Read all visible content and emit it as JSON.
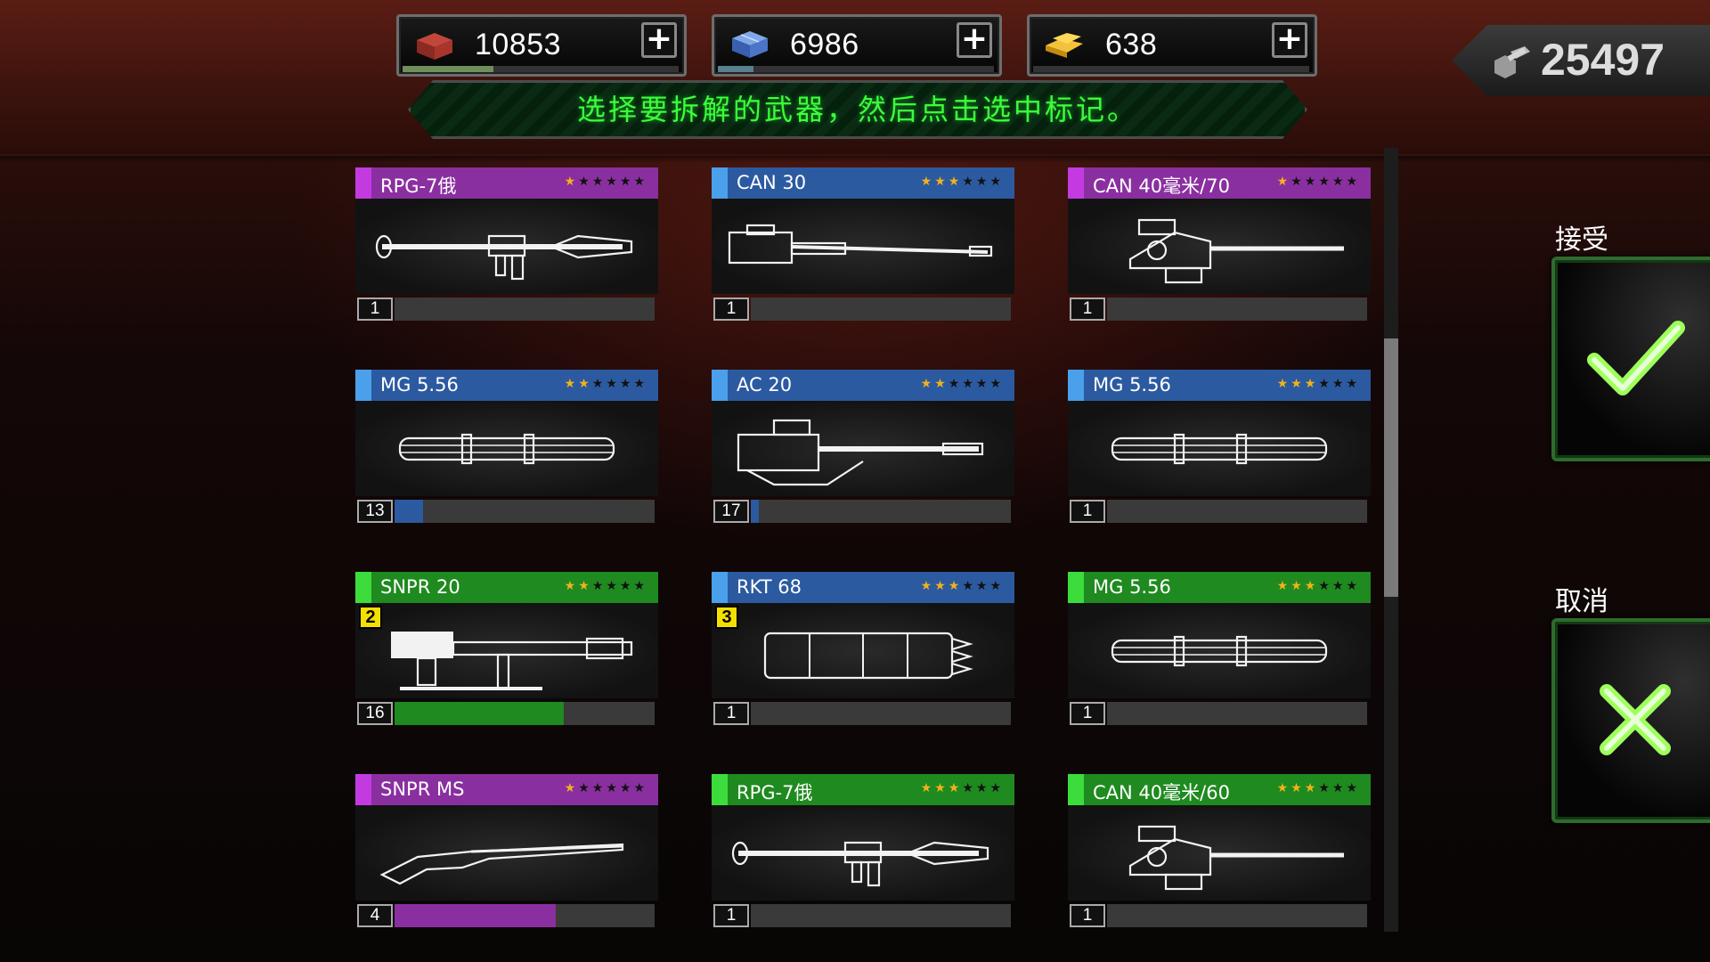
{
  "currencies": [
    {
      "id": "steel",
      "icon": "steel-ingot-icon",
      "value": "10853",
      "bar_fill": 0.33,
      "bar_color": "#6f8f5a"
    },
    {
      "id": "crystal",
      "icon": "blue-crystal-icon",
      "value": "6986",
      "bar_fill": 0.13,
      "bar_color": "#5a7f8f"
    },
    {
      "id": "gold",
      "icon": "gold-bar-icon",
      "value": "638",
      "bar_fill": 0.0,
      "bar_color": "#8a7a3a"
    }
  ],
  "total": {
    "icon": "bolt-part-icon",
    "value": "25497"
  },
  "banner": {
    "text": "选择要拆解的武器，然后点击选中标记。"
  },
  "actions": {
    "accept_label": "接受",
    "cancel_label": "取消"
  },
  "colors": {
    "purple": "#8a2fa0",
    "blue": "#2c5aa0",
    "green": "#1f8a1f",
    "purple_accent": "#c33be0",
    "blue_accent": "#4aa0ea",
    "green_accent": "#3ddc3d"
  },
  "scroll": {
    "position": 0.25
  },
  "weapons": [
    {
      "name": "RPG-7俄",
      "rarity": "purple",
      "stars": 1,
      "icon": "rpg-launcher-icon",
      "count": "1",
      "progress": 0.0,
      "badge": ""
    },
    {
      "name": "CAN 30",
      "rarity": "blue",
      "stars": 3,
      "icon": "cannon-icon",
      "count": "1",
      "progress": 0.0,
      "badge": ""
    },
    {
      "name": "CAN 40毫米/70",
      "rarity": "purple",
      "stars": 1,
      "icon": "heavy-cannon-icon",
      "count": "1",
      "progress": 0.0,
      "badge": ""
    },
    {
      "name": "MG 5.56",
      "rarity": "blue",
      "stars": 2,
      "icon": "gatling-gun-icon",
      "count": "13",
      "progress": 0.11,
      "badge": ""
    },
    {
      "name": "AC 20",
      "rarity": "blue",
      "stars": 2,
      "icon": "autocannon-icon",
      "count": "17",
      "progress": 0.03,
      "badge": ""
    },
    {
      "name": "MG 5.56",
      "rarity": "blue",
      "stars": 3,
      "icon": "gatling-gun-icon",
      "count": "1",
      "progress": 0.0,
      "badge": ""
    },
    {
      "name": "SNPR 20",
      "rarity": "green",
      "stars": 2,
      "icon": "anti-material-rifle-icon",
      "count": "16",
      "progress": 0.65,
      "badge": "2"
    },
    {
      "name": "RKT 68",
      "rarity": "blue",
      "stars": 3,
      "icon": "rocket-pod-icon",
      "count": "1",
      "progress": 0.0,
      "badge": "3"
    },
    {
      "name": "MG 5.56",
      "rarity": "green",
      "stars": 3,
      "icon": "gatling-gun-icon",
      "count": "1",
      "progress": 0.0,
      "badge": ""
    },
    {
      "name": "SNPR MS",
      "rarity": "purple",
      "stars": 1,
      "icon": "sniper-rifle-icon",
      "count": "4",
      "progress": 0.62,
      "badge": ""
    },
    {
      "name": "RPG-7俄",
      "rarity": "green",
      "stars": 3,
      "icon": "rpg-launcher-icon",
      "count": "1",
      "progress": 0.0,
      "badge": ""
    },
    {
      "name": "CAN 40毫米/60",
      "rarity": "green",
      "stars": 3,
      "icon": "heavy-cannon-icon",
      "count": "1",
      "progress": 0.0,
      "badge": ""
    }
  ]
}
